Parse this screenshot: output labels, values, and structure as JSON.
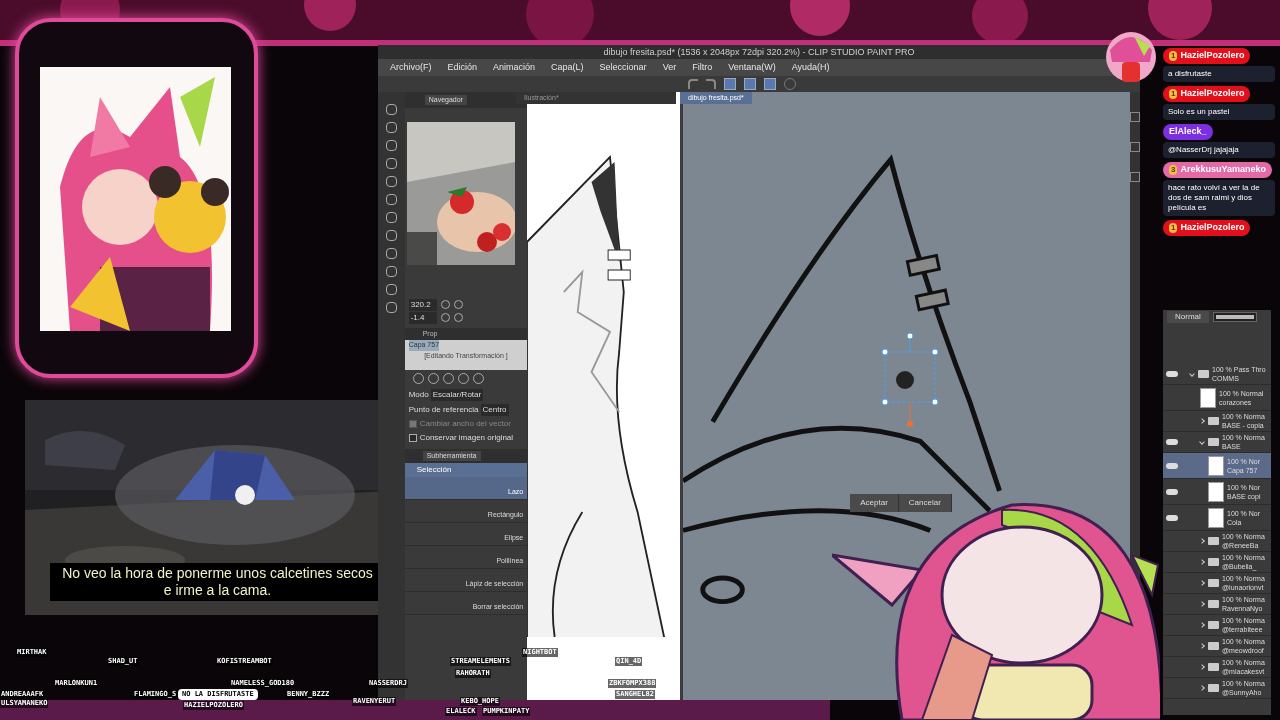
{
  "window": {
    "title": "dibujo fresita.psd* (1536 x 2048px 72dpi 320.2%) - CLIP STUDIO PAINT PRO",
    "menu": [
      "Archivo(F)",
      "Edición",
      "Animación",
      "Capa(L)",
      "Seleccionar",
      "Ver",
      "Filtro",
      "Ventana(W)",
      "Ayuda(H)"
    ],
    "doc_tabs": [
      {
        "label": "Ilustración*",
        "selected": false
      },
      {
        "label": "dibujo fresita.psd*",
        "selected": true
      }
    ]
  },
  "navigator": {
    "tab": "Navegador",
    "zoom": "320.2",
    "angle": "-1.4"
  },
  "tool_property": {
    "tab": "Prop",
    "layer": "Capa 757",
    "status": "[Editando Transformación ]",
    "fields": [
      {
        "label": "Modo",
        "value": "Escalar/Rotar"
      },
      {
        "label": "Punto de referencia",
        "value": "Centro"
      }
    ],
    "options": [
      {
        "label": "Cambiar ancho del vector",
        "checked": true,
        "disabled": true
      },
      {
        "label": "Conservar imagen original",
        "checked": false,
        "disabled": false
      }
    ]
  },
  "sub_tool": {
    "tab": "Subherramienta",
    "group": "Selección",
    "items": [
      {
        "label": "Lazo",
        "selected": true
      },
      {
        "label": "Rectángulo",
        "selected": false
      },
      {
        "label": "Elipse",
        "selected": false
      },
      {
        "label": "Polilínea",
        "selected": false
      },
      {
        "label": "Lápiz de selección",
        "selected": false
      },
      {
        "label": "Borrar selección",
        "selected": false
      }
    ]
  },
  "canvas": {
    "buttons": [
      "Aceptar",
      "Cancelar"
    ]
  },
  "layers": {
    "blend": "Normal",
    "opacity": {
      "level": 1
    },
    "items": [
      {
        "kind": "folder",
        "mode": "100 % Pass Thro",
        "name": "COMMS",
        "visible": true,
        "expanded": true,
        "selected": false,
        "children": [
          {
            "kind": "layer",
            "mode": "100 % Normal",
            "name": "corazones",
            "visible": false,
            "selected": false
          },
          {
            "kind": "folder",
            "mode": "100 % Norma",
            "name": "BASE - copia",
            "visible": false,
            "expanded": false,
            "selected": false
          },
          {
            "kind": "folder",
            "mode": "100 % Norma",
            "name": "BASE",
            "visible": true,
            "expanded": true,
            "selected": false,
            "children": [
              {
                "kind": "layer",
                "mode": "100 % Nor",
                "name": "Capa 757",
                "visible": true,
                "selected": true
              },
              {
                "kind": "layer",
                "mode": "100 % Nor",
                "name": "BASE copi",
                "visible": true,
                "selected": false
              },
              {
                "kind": "layer",
                "mode": "100 % Nor",
                "name": "Cola",
                "visible": true,
                "selected": false
              }
            ]
          },
          {
            "kind": "folder",
            "mode": "100 % Norma",
            "name": "@ReneeBa",
            "visible": false,
            "expanded": false,
            "selected": false
          },
          {
            "kind": "folder",
            "mode": "100 % Norma",
            "name": "@Bubelia_",
            "visible": false,
            "expanded": false,
            "selected": false
          },
          {
            "kind": "folder",
            "mode": "100 % Norma",
            "name": "@lunaorionvt",
            "visible": false,
            "expanded": false,
            "selected": false
          },
          {
            "kind": "folder",
            "mode": "100 % Norma",
            "name": "RavennaNyo",
            "visible": false,
            "expanded": false,
            "selected": false
          },
          {
            "kind": "folder",
            "mode": "100 % Norma",
            "name": "@terrabiteee",
            "visible": false,
            "expanded": false,
            "selected": false
          },
          {
            "kind": "folder",
            "mode": "100 % Norma",
            "name": "@meowdroof",
            "visible": false,
            "expanded": false,
            "selected": false
          },
          {
            "kind": "folder",
            "mode": "100 % Norma",
            "name": "@miacakesvt",
            "visible": false,
            "expanded": false,
            "selected": false
          },
          {
            "kind": "folder",
            "mode": "100 % Norma",
            "name": "@SunnyAho",
            "visible": false,
            "expanded": false,
            "selected": false
          }
        ]
      }
    ]
  },
  "chat": [
    {
      "name": "HazielPozolero",
      "color": "#e3101c",
      "gift_count": "1",
      "text": "a disfrutaste"
    },
    {
      "name": "HazielPozolero",
      "color": "#e3101c",
      "gift_count": "1",
      "text": "Solo es un pastel"
    },
    {
      "name": "ElAleck_",
      "color": "#7b2fe0",
      "text": "@NasserDrj jajajaja"
    },
    {
      "name": "ArekkusuYamaneko",
      "color": "#e26aa6",
      "gift_count": "3",
      "text": "hace rato volví a ver la de dos de sam raimi y dios película es"
    },
    {
      "name": "HazielPozolero",
      "color": "#e3101c",
      "gift_count": "1"
    }
  ],
  "video": {
    "subtitle": "No veo la hora de ponerme unos calcetines secos e irme a la cama."
  },
  "viewers": [
    "MIRTHAK",
    "SHAD_UT",
    "KOFISTREAMBOT",
    "STREAMELEMENTS",
    "NIGHTBOT",
    "QIN_4D",
    "MARLONKUN1",
    "NAMELESS_GOD180",
    "NASSERDRJ",
    "RAHORATH",
    "ZBKFOMPX388",
    "ANDREAAAFK",
    "FLAMINGO_S",
    "BENNY_BZZZ",
    "SANGHEL82",
    "ULSYAMANEKO",
    "HAZIELPOZOLERO",
    "RAVENYERUT",
    "KEBO_HOPE",
    "ELALECK",
    "PUMPKINPATY"
  ],
  "speech_bubble": "NO LA DISFRUTASTE"
}
